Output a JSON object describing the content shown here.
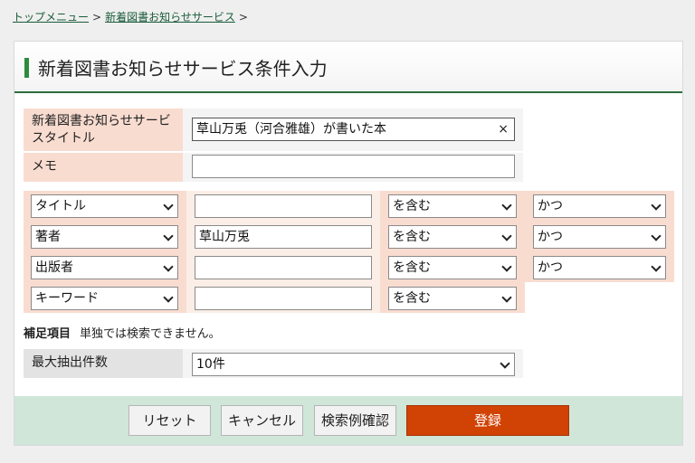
{
  "breadcrumb": {
    "home": "トップメニュー",
    "current": "新着図書お知らせサービス",
    "separator": ">"
  },
  "page": {
    "title": "新着図書お知らせサービス条件入力"
  },
  "form": {
    "service_title": {
      "label": "新着図書お知らせサービスタイトル",
      "value": "草山万兎（河合雅雄）が書いた本",
      "clear_icon": "×"
    },
    "memo": {
      "label": "メモ",
      "value": ""
    },
    "conditions": [
      {
        "field": "タイトル",
        "value": "",
        "match": "を含む",
        "logic": "かつ"
      },
      {
        "field": "著者",
        "value": "草山万兎",
        "match": "を含む",
        "logic": "かつ"
      },
      {
        "field": "出版者",
        "value": "",
        "match": "を含む",
        "logic": "かつ"
      },
      {
        "field": "キーワード",
        "value": "",
        "match": "を含む"
      }
    ],
    "note": {
      "heading": "補足項目",
      "text": "単独では検索できません。"
    },
    "max_results": {
      "label": "最大抽出件数",
      "value": "10件"
    }
  },
  "buttons": {
    "reset": "リセット",
    "cancel": "キャンセル",
    "preview": "検索例確認",
    "submit": "登録"
  },
  "colors": {
    "accent_green": "#2e6e3e",
    "label_bg": "#f9dcd0",
    "footer_bg": "#cfe6d9",
    "primary_button": "#d14205"
  }
}
